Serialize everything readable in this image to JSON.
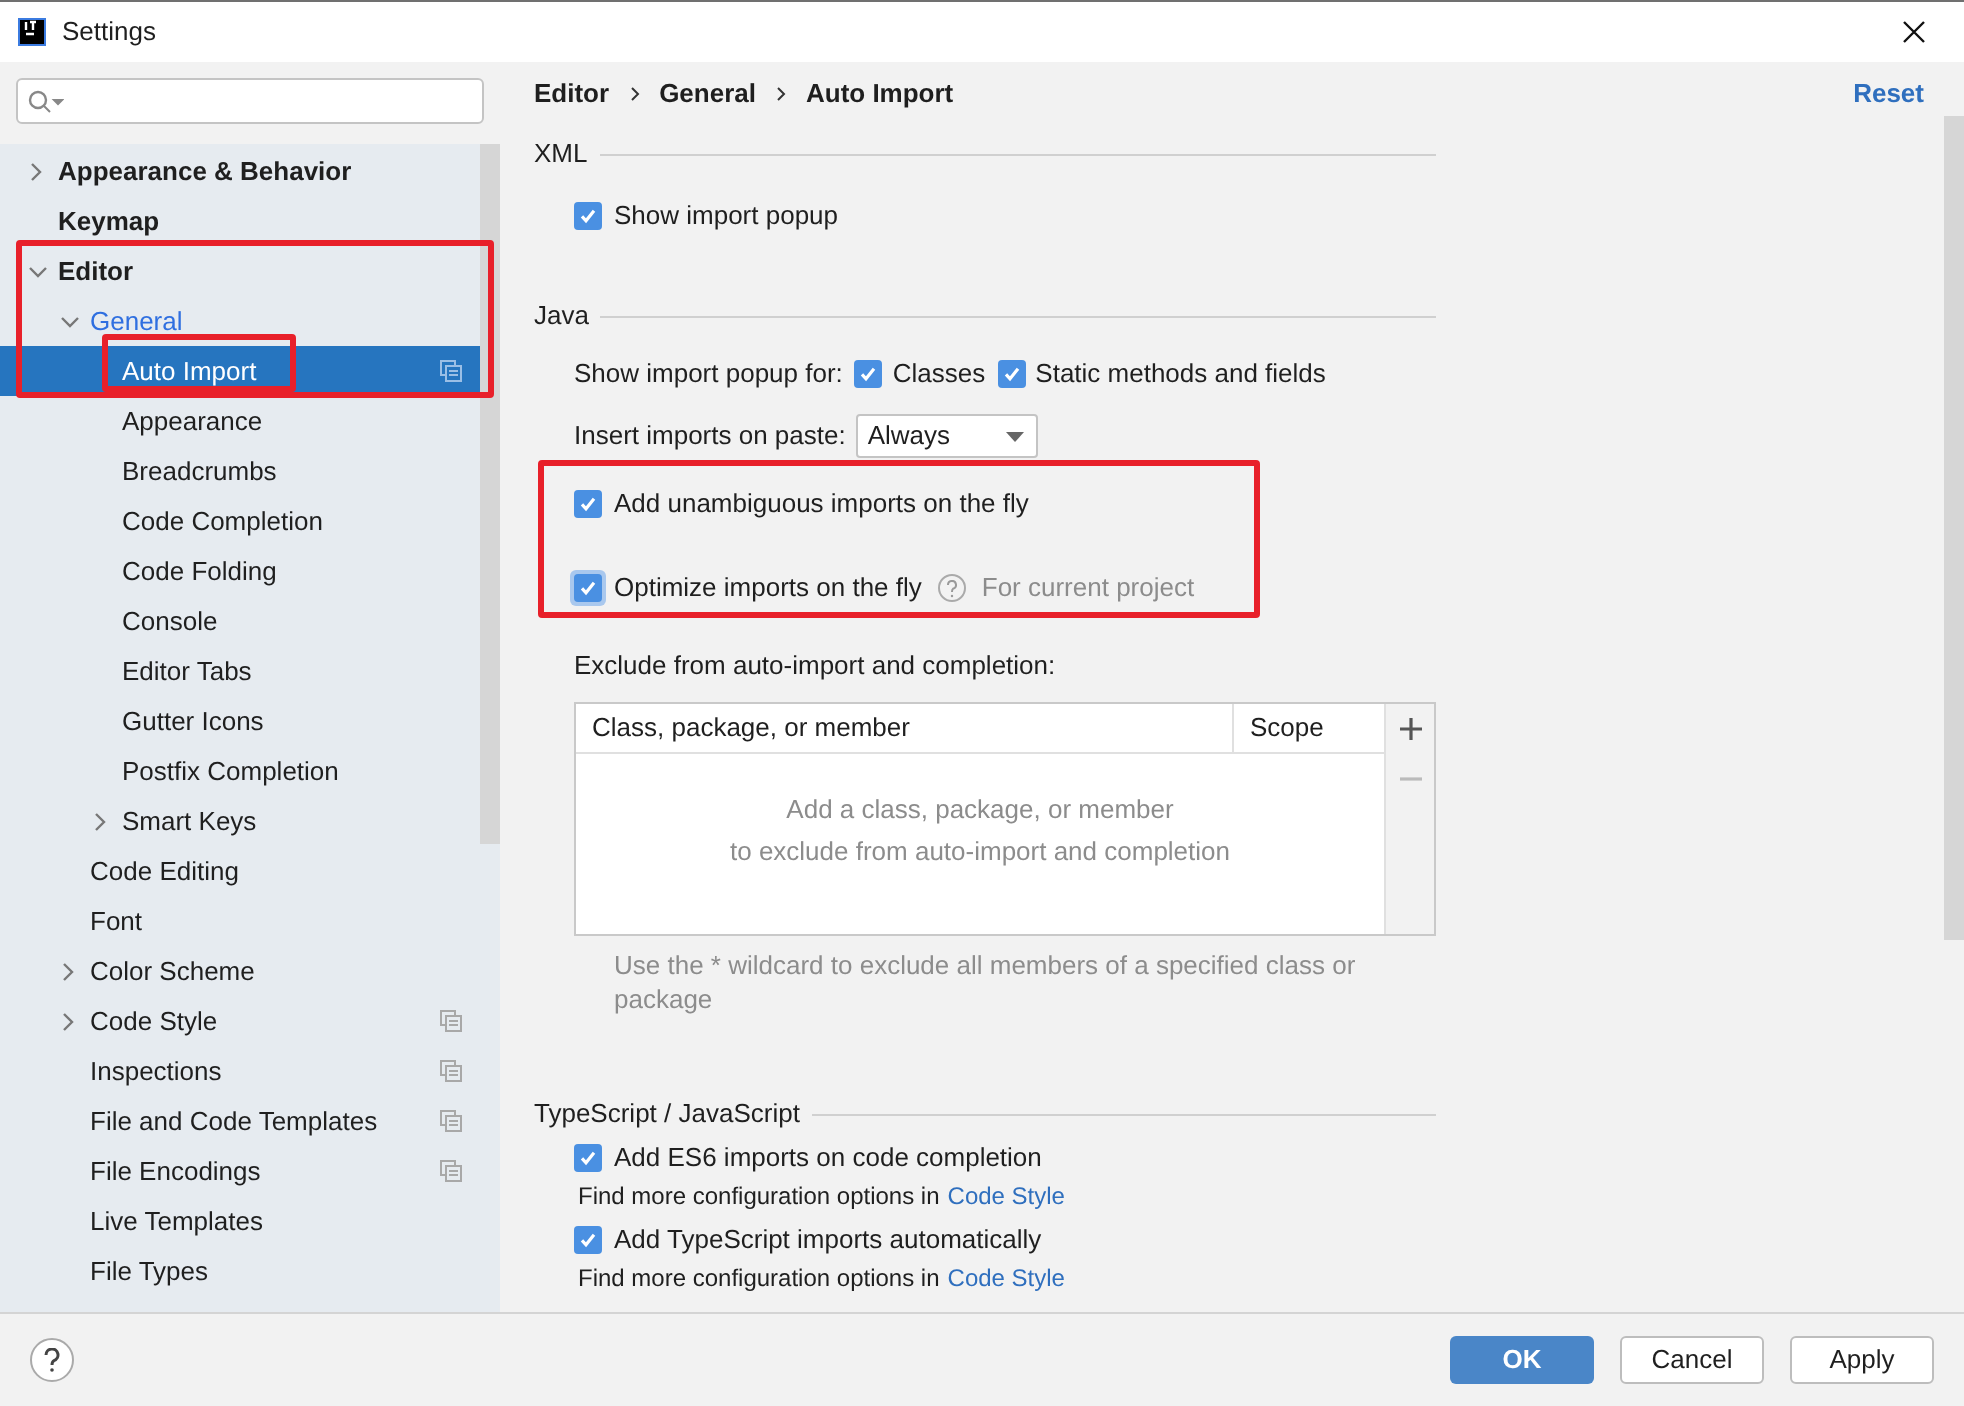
{
  "window": {
    "title": "Settings"
  },
  "sidebar": {
    "items": [
      {
        "label": "Appearance & Behavior",
        "expanded": false,
        "selected": false,
        "modified": false,
        "project_level": false
      },
      {
        "label": "Keymap",
        "selected": false,
        "modified": false,
        "project_level": false
      },
      {
        "label": "Editor",
        "expanded": true,
        "selected": false,
        "modified": false,
        "project_level": false,
        "children": [
          {
            "label": "General",
            "expanded": true,
            "selected": false,
            "modified": true,
            "project_level": false,
            "children": [
              {
                "label": "Auto Import",
                "selected": true,
                "modified": false,
                "project_level": true
              },
              {
                "label": "Appearance",
                "selected": false,
                "modified": false,
                "project_level": false
              },
              {
                "label": "Breadcrumbs",
                "selected": false,
                "modified": false,
                "project_level": false
              },
              {
                "label": "Code Completion",
                "selected": false,
                "modified": false,
                "project_level": false
              },
              {
                "label": "Code Folding",
                "selected": false,
                "modified": false,
                "project_level": false
              },
              {
                "label": "Console",
                "selected": false,
                "modified": false,
                "project_level": false
              },
              {
                "label": "Editor Tabs",
                "selected": false,
                "modified": false,
                "project_level": false
              },
              {
                "label": "Gutter Icons",
                "selected": false,
                "modified": false,
                "project_level": false
              },
              {
                "label": "Postfix Completion",
                "selected": false,
                "modified": false,
                "project_level": false
              },
              {
                "label": "Smart Keys",
                "expanded": false,
                "selected": false,
                "modified": false,
                "project_level": false
              }
            ]
          },
          {
            "label": "Code Editing",
            "selected": false,
            "modified": false,
            "project_level": false
          },
          {
            "label": "Font",
            "selected": false,
            "modified": false,
            "project_level": false
          },
          {
            "label": "Color Scheme",
            "expanded": false,
            "selected": false,
            "modified": false,
            "project_level": false
          },
          {
            "label": "Code Style",
            "expanded": false,
            "selected": false,
            "modified": false,
            "project_level": true
          },
          {
            "label": "Inspections",
            "selected": false,
            "modified": false,
            "project_level": true
          },
          {
            "label": "File and Code Templates",
            "selected": false,
            "modified": false,
            "project_level": true
          },
          {
            "label": "File Encodings",
            "selected": false,
            "modified": false,
            "project_level": true
          },
          {
            "label": "Live Templates",
            "selected": false,
            "modified": false,
            "project_level": false
          },
          {
            "label": "File Types",
            "selected": false,
            "modified": false,
            "project_level": false
          }
        ]
      }
    ]
  },
  "content": {
    "breadcrumb": [
      "Editor",
      "General",
      "Auto Import"
    ],
    "reset": "Reset",
    "sections": [
      {
        "title": "XML",
        "rows": [
          {
            "kind": "checkbox",
            "label": "Show import popup",
            "checked": true
          }
        ]
      },
      {
        "title": "Java",
        "rows": [
          {
            "kind": "checkgroup",
            "label": "Show import popup for:",
            "options": [
              {
                "label": "Classes",
                "checked": true
              },
              {
                "label": "Static methods and fields",
                "checked": true
              }
            ]
          },
          {
            "kind": "dropdown",
            "label": "Insert imports on paste:",
            "value": "Always"
          },
          {
            "kind": "checkbox",
            "label": "Add unambiguous imports on the fly",
            "checked": true
          },
          {
            "kind": "checkbox",
            "label": "Optimize imports on the fly",
            "checked": true,
            "focused": true,
            "hint": "For current project"
          },
          {
            "kind": "table",
            "caption": "Exclude from auto-import and completion:",
            "columns": [
              "Class, package, or member",
              "Scope"
            ],
            "empty_text": [
              "Add a class, package, or member",
              "to exclude from auto-import and completion"
            ],
            "note": "Use the * wildcard to exclude all members of a specified class or package"
          }
        ]
      },
      {
        "title": "TypeScript / JavaScript",
        "rows": [
          {
            "kind": "checkbox",
            "label": "Add ES6 imports on code completion",
            "checked": true
          },
          {
            "kind": "linknote",
            "text": "Find more configuration options in",
            "link": "Code Style"
          },
          {
            "kind": "checkbox",
            "label": "Add TypeScript imports automatically",
            "checked": true
          },
          {
            "kind": "linknote",
            "text": "Find more configuration options in",
            "link": "Code Style"
          }
        ]
      }
    ]
  },
  "buttons": [
    {
      "label": "OK",
      "default": true
    },
    {
      "label": "Cancel",
      "default": false
    },
    {
      "label": "Apply",
      "default": false
    }
  ]
}
